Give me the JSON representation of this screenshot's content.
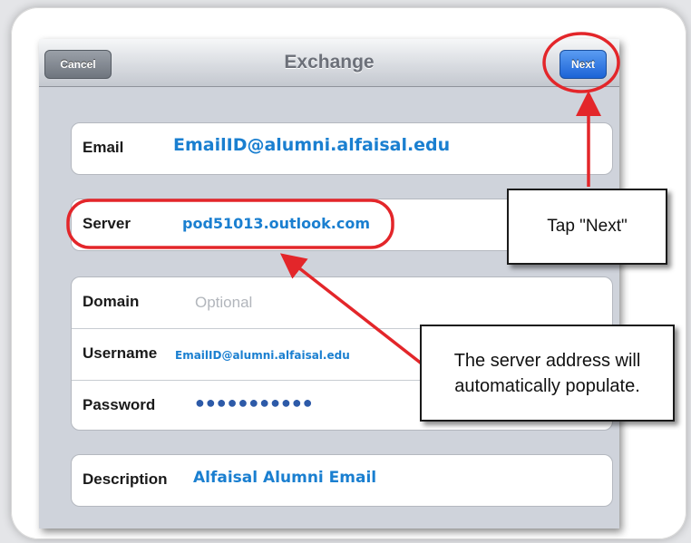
{
  "navbar": {
    "title": "Exchange",
    "cancel_label": "Cancel",
    "next_label": "Next"
  },
  "form": {
    "email_label": "Email",
    "email_value": "EmailID@alumni.alfaisal.edu",
    "server_label": "Server",
    "server_value": "pod51013.outlook.com",
    "domain_label": "Domain",
    "domain_placeholder": "Optional",
    "username_label": "Username",
    "username_value": "EmailID@alumni.alfaisal.edu",
    "password_label": "Password",
    "password_value": "●●●●●●●●●●●",
    "description_label": "Description",
    "description_value": "Alfaisal Alumni Email"
  },
  "annotations": {
    "tap_next": "Tap \"Next\"",
    "server_note_line1": "The server address will",
    "server_note_line2": "automatically populate.",
    "highlight_color": "#e3262a"
  }
}
